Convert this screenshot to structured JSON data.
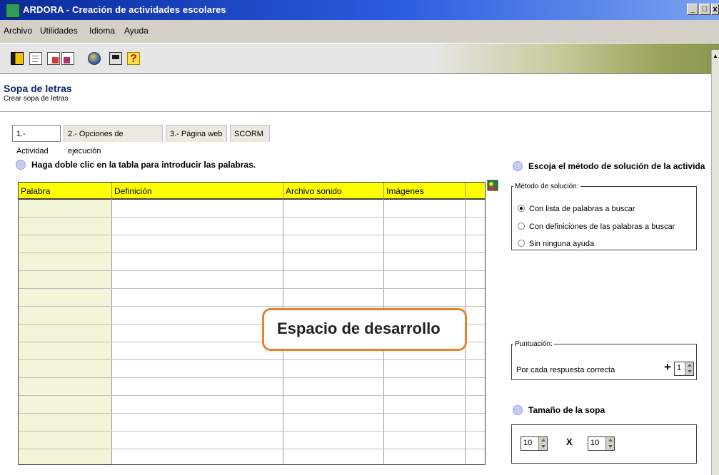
{
  "window": {
    "title": "ARDORA - Creación de actividades escolares"
  },
  "menu": [
    "Archivo",
    "Utilidades",
    "Idioma",
    "Ayuda"
  ],
  "toolbar_icons": [
    "book-icon",
    "new-page-icon",
    "copy-pages-icon",
    "paste-pages-icon",
    "globe-icon",
    "printer-icon",
    "help-icon"
  ],
  "header": {
    "title": "Sopa de letras",
    "subtitle": "Crear sopa de letras"
  },
  "tabs": [
    "1.- Actividad",
    "2.- Opciones de ejecución",
    "3.- Página web",
    "SCORM"
  ],
  "instructions": {
    "left": "Haga doble clic en la tabla para introducir las palabras.",
    "right": "Escoja el método de solución de la activida",
    "size": "Tamaño de la sopa"
  },
  "table": {
    "columns": [
      "Palabra",
      "Definición",
      "Archivo sonido",
      "Imágenes"
    ]
  },
  "callout": "Espacio de desarrollo",
  "solution": {
    "legend": "Método de solución:",
    "options": [
      "Con lista de palabras a buscar",
      "Con definiciones de las palabras a buscar",
      "Sin ninguna ayuda"
    ],
    "selected": "Con lista de palabras a buscar"
  },
  "score": {
    "legend": "Puntuación:",
    "label": "Por cada respuesta correcta",
    "plus": "+",
    "value": "1"
  },
  "size": {
    "width": "10",
    "times": "X",
    "height": "10"
  },
  "window_buttons": {
    "minimize": "_",
    "restore": "□",
    "close": "x"
  }
}
